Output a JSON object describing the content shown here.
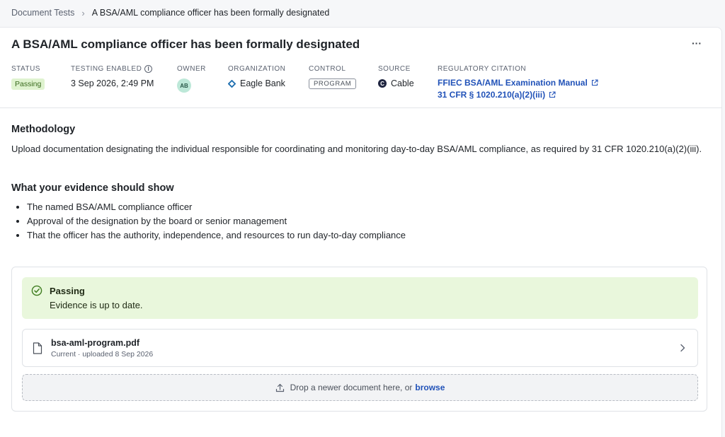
{
  "breadcrumb": {
    "parent": "Document Tests",
    "separator": "›",
    "current": "A BSA/AML compliance officer has been formally designated"
  },
  "header": {
    "title": "A BSA/AML compliance officer has been formally designated",
    "more_label": "···"
  },
  "meta": {
    "status": {
      "label": "STATUS",
      "value": "Passing"
    },
    "testing_enabled": {
      "label": "TESTING ENABLED",
      "value": "3 Sep 2026, 2:49 PM",
      "info_icon": "info-icon"
    },
    "owner": {
      "label": "OWNER",
      "initials": "AB"
    },
    "organization": {
      "label": "ORGANIZATION",
      "value": "Eagle Bank"
    },
    "control": {
      "label": "CONTROL",
      "value": "PROGRAM"
    },
    "source": {
      "label": "SOURCE",
      "value": "Cable",
      "icon_letter": "C"
    },
    "citation": {
      "label": "REGULATORY CITATION",
      "links": [
        "FFIEC BSA/AML Examination Manual",
        "31 CFR § 1020.210(a)(2)(iii)"
      ]
    }
  },
  "methodology": {
    "title": "Methodology",
    "text": "Upload documentation designating the individual responsible for coordinating and monitoring day-to-day BSA/AML compliance, as required by 31 CFR 1020.210(a)(2)(iii)."
  },
  "evidence_requirements": {
    "title": "What your evidence should show",
    "items": [
      "The named BSA/AML compliance officer",
      "Approval of the designation by the board or senior management",
      "That the officer has the authority, independence, and resources to run day-to-day compliance"
    ]
  },
  "evidence": {
    "status_title": "Passing",
    "status_sub": "Evidence is up to date.",
    "file_name": "bsa-aml-program.pdf",
    "file_meta": "Current · uploaded 8 Sep 2026",
    "dropzone_text": "Drop a newer document here, or",
    "dropzone_link": "browse"
  },
  "colors": {
    "passing_bg": "#dff3cf",
    "banner_bg": "#e9f7dc",
    "link": "#2152b8"
  }
}
